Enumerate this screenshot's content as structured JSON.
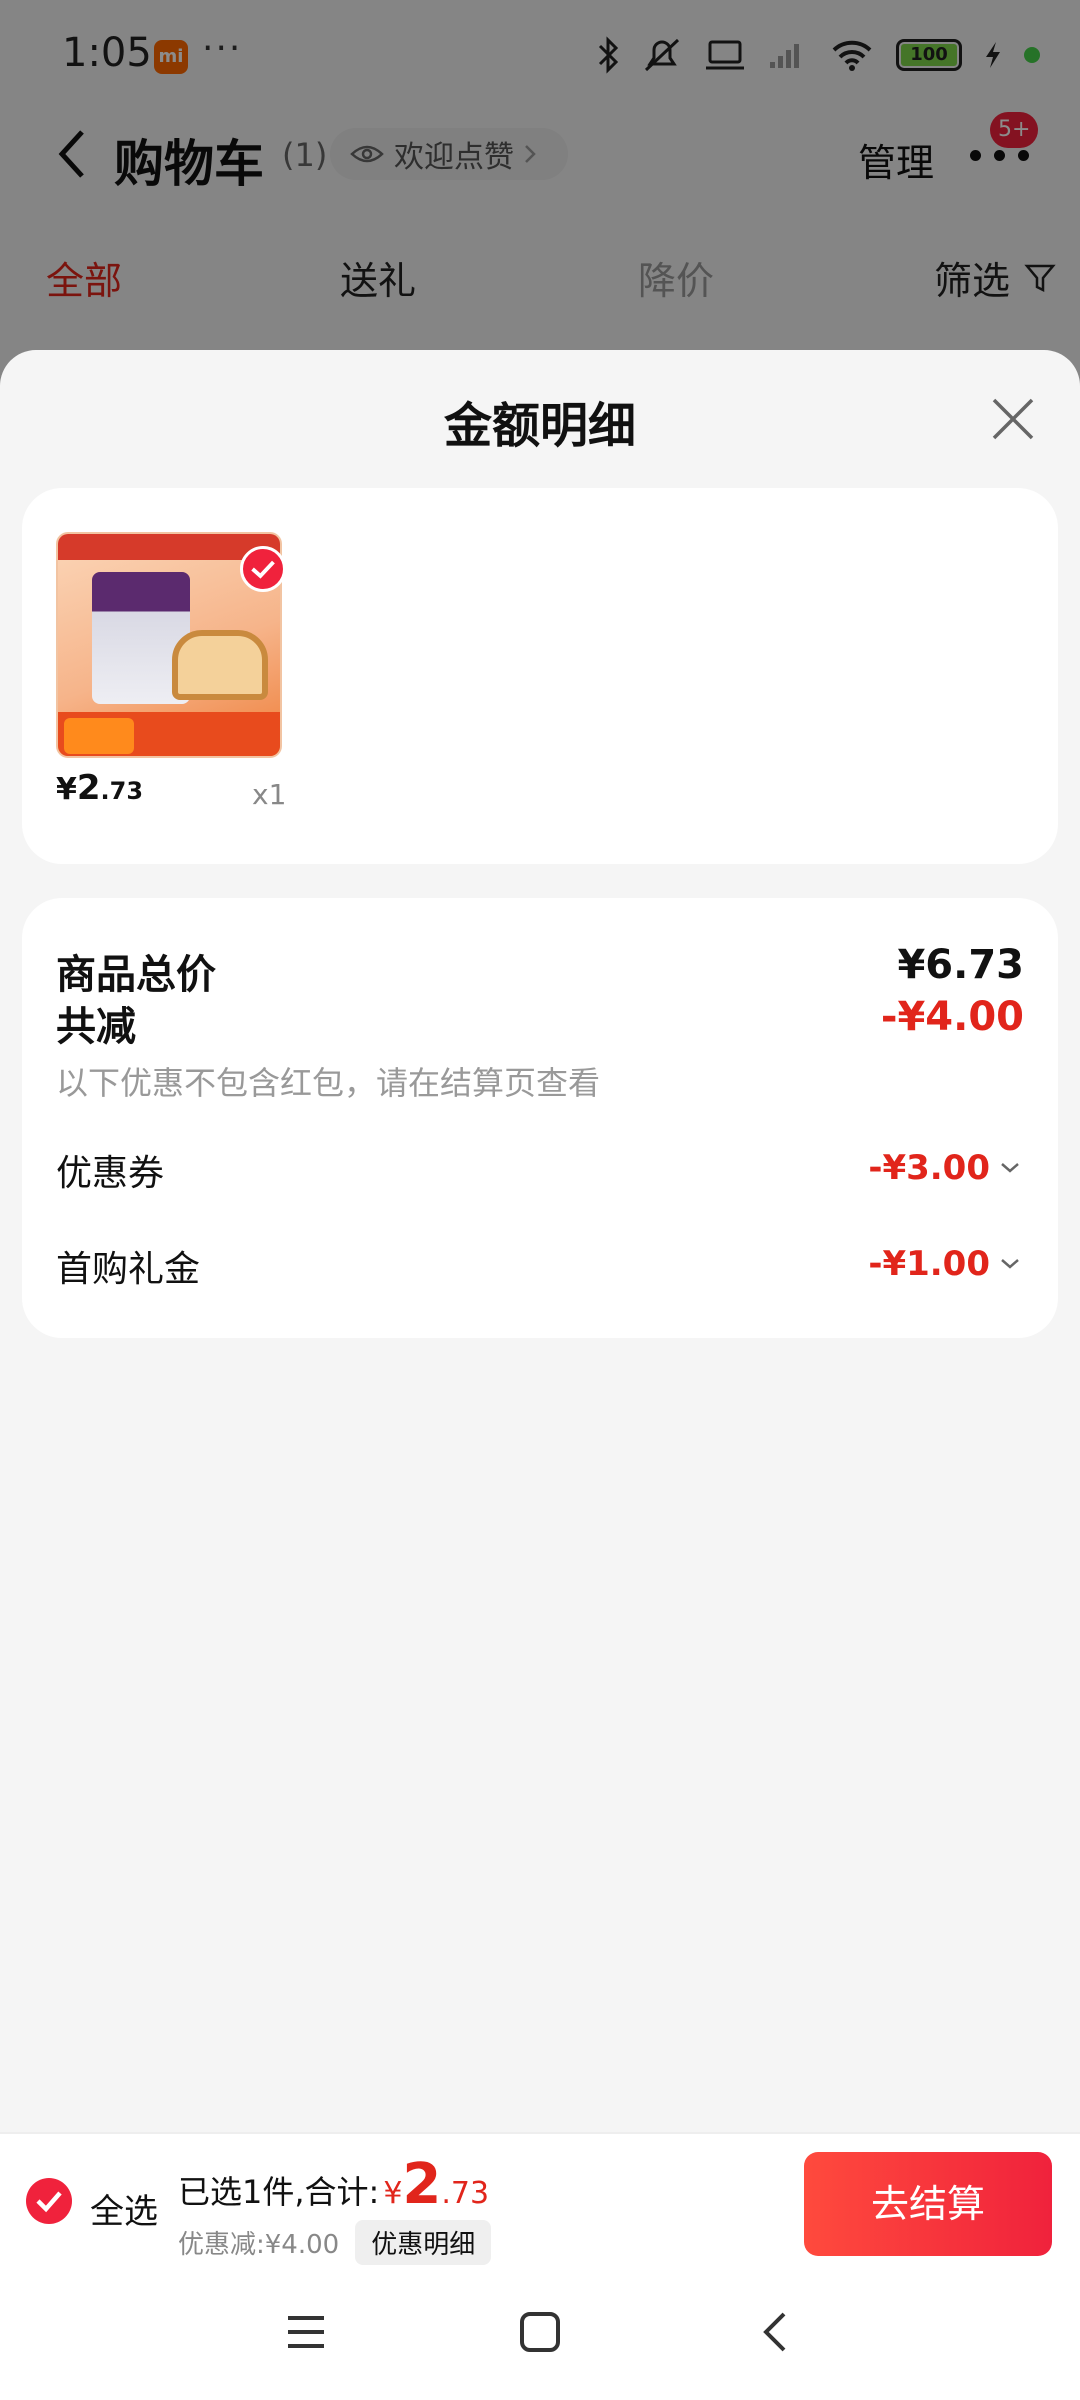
{
  "status": {
    "time": "1:05",
    "carrier_badge": "mi",
    "dots": "···",
    "battery": "100",
    "icons": [
      "bluetooth-icon",
      "silent-icon",
      "laptop-icon",
      "signal-icon",
      "wifi-icon",
      "battery-icon",
      "charging-icon"
    ]
  },
  "header": {
    "title": "购物车",
    "count": "(1)",
    "welcome": "欢迎点赞",
    "manage": "管理",
    "more_badge": "5+"
  },
  "tabs": [
    "全部",
    "送礼",
    "降价"
  ],
  "filter_label": "筛选",
  "sheet": {
    "title": "金额明细",
    "product": {
      "price_yen": "¥",
      "price_int": "2",
      "price_dec": ".73",
      "qty": "x1"
    },
    "total_label": "商品总价",
    "total_value": "¥6.73",
    "reduce_label": "共减",
    "reduce_value": "-¥4.00",
    "note": "以下优惠不包含红包，请在结算页查看",
    "coupon_label": "优惠券",
    "coupon_value": "-¥3.00",
    "gift_label": "首购礼金",
    "gift_value": "-¥1.00"
  },
  "bottom": {
    "select_all": "全选",
    "selected_text": "已选1件,合计:",
    "total_yen": "¥",
    "total_int": "2",
    "total_dec": ".73",
    "discount_text": "优惠减:¥4.00",
    "detail_pill": "优惠明细",
    "checkout": "去结算"
  },
  "colors": {
    "accent_red": "#e1251b",
    "button_red": "#f0223c",
    "background": "#f5f5f5"
  }
}
